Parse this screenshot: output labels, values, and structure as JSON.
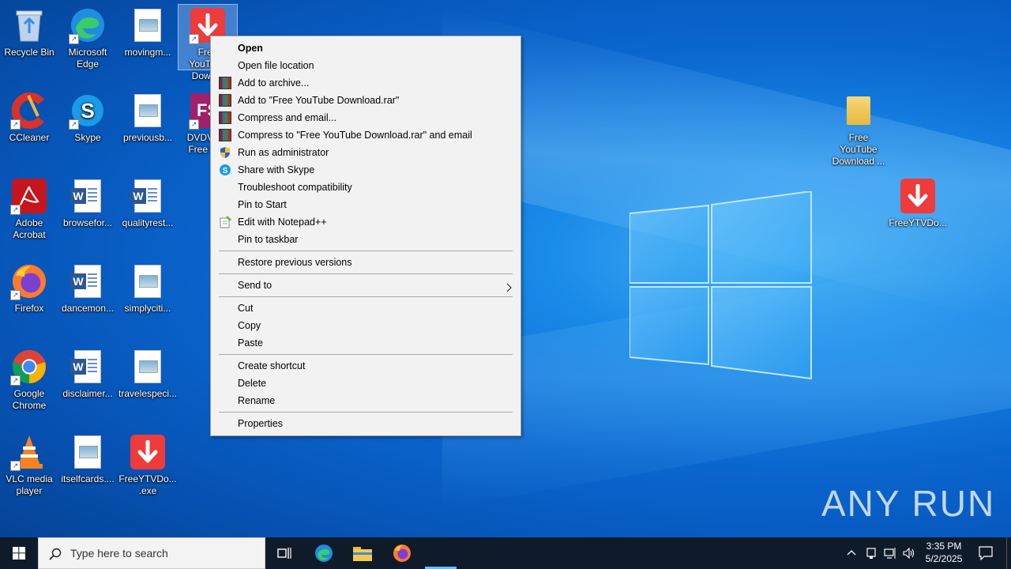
{
  "desktop_icons": [
    {
      "id": "recycle",
      "label": "Recycle Bin",
      "icon": "recycle-bin-icon"
    },
    {
      "id": "edge",
      "label": "Microsoft Edge",
      "icon": "edge-icon"
    },
    {
      "id": "moving",
      "label": "movingm...",
      "icon": "image-file-icon"
    },
    {
      "id": "fyd",
      "label": "Free YouTube Down...",
      "icon": "download-arrow-icon"
    },
    {
      "id": "ccleaner",
      "label": "CCleaner",
      "icon": "ccleaner-icon"
    },
    {
      "id": "skype",
      "label": "Skype",
      "icon": "skype-icon"
    },
    {
      "id": "previous",
      "label": "previousb...",
      "icon": "image-file-icon"
    },
    {
      "id": "dvd",
      "label": "DVDVid... Free St...",
      "icon": "dvd-video-icon"
    },
    {
      "id": "adobe",
      "label": "Adobe Acrobat",
      "icon": "adobe-acrobat-icon"
    },
    {
      "id": "browse",
      "label": "browsefor...",
      "icon": "word-doc-icon"
    },
    {
      "id": "quality",
      "label": "qualityrest...",
      "icon": "word-doc-icon"
    },
    {
      "id": "firefox",
      "label": "Firefox",
      "icon": "firefox-icon"
    },
    {
      "id": "dance",
      "label": "dancemon...",
      "icon": "word-doc-icon"
    },
    {
      "id": "simply",
      "label": "simplyciti...",
      "icon": "image-file-icon"
    },
    {
      "id": "chrome",
      "label": "Google Chrome",
      "icon": "chrome-icon"
    },
    {
      "id": "disclaimer",
      "label": "disclaimer...",
      "icon": "word-doc-icon"
    },
    {
      "id": "travel",
      "label": "travelespeci...",
      "icon": "image-file-icon"
    },
    {
      "id": "vlc",
      "label": "VLC media player",
      "icon": "vlc-icon"
    },
    {
      "id": "itself",
      "label": "itselfcards....",
      "icon": "image-file-icon"
    },
    {
      "id": "freeexe",
      "label": "FreeYTVDo... .exe",
      "icon": "download-arrow-icon"
    },
    {
      "id": "folder",
      "label": "Free YouTube Download ...",
      "icon": "folder-icon"
    },
    {
      "id": "freeyt",
      "label": "FreeYTVDo...",
      "icon": "download-arrow-icon"
    }
  ],
  "context_menu": {
    "items": [
      {
        "label": "Open",
        "icon": "",
        "bold": true
      },
      {
        "label": "Open file location",
        "icon": ""
      },
      {
        "label": "Add to archive...",
        "icon": "winrar-icon"
      },
      {
        "label": "Add to \"Free YouTube Download.rar\"",
        "icon": "winrar-icon"
      },
      {
        "label": "Compress and email...",
        "icon": "winrar-icon"
      },
      {
        "label": "Compress to \"Free YouTube Download.rar\" and email",
        "icon": "winrar-icon"
      },
      {
        "label": "Run as administrator",
        "icon": "uac-shield-icon"
      },
      {
        "label": "Share with Skype",
        "icon": "skype-icon"
      },
      {
        "label": "Troubleshoot compatibility",
        "icon": ""
      },
      {
        "label": "Pin to Start",
        "icon": ""
      },
      {
        "label": "Edit with Notepad++",
        "icon": "notepadpp-icon"
      },
      {
        "label": "Pin to taskbar",
        "icon": ""
      },
      {
        "label": "Restore previous versions",
        "icon": ""
      },
      {
        "label": "Send to",
        "icon": "",
        "submenu": true
      },
      {
        "label": "Cut",
        "icon": ""
      },
      {
        "label": "Copy",
        "icon": ""
      },
      {
        "label": "Paste",
        "icon": ""
      },
      {
        "label": "Create shortcut",
        "icon": ""
      },
      {
        "label": "Delete",
        "icon": ""
      },
      {
        "label": "Rename",
        "icon": ""
      },
      {
        "label": "Properties",
        "icon": ""
      }
    ]
  },
  "taskbar": {
    "search_placeholder": "Type here to search",
    "time": "3:35 PM",
    "date": "5/2/2025"
  },
  "watermark": "ANY RUN",
  "colors": {
    "accent": "#0078d7",
    "menu_bg": "#f2f2f2",
    "taskbar_bg": "#101b2a"
  }
}
